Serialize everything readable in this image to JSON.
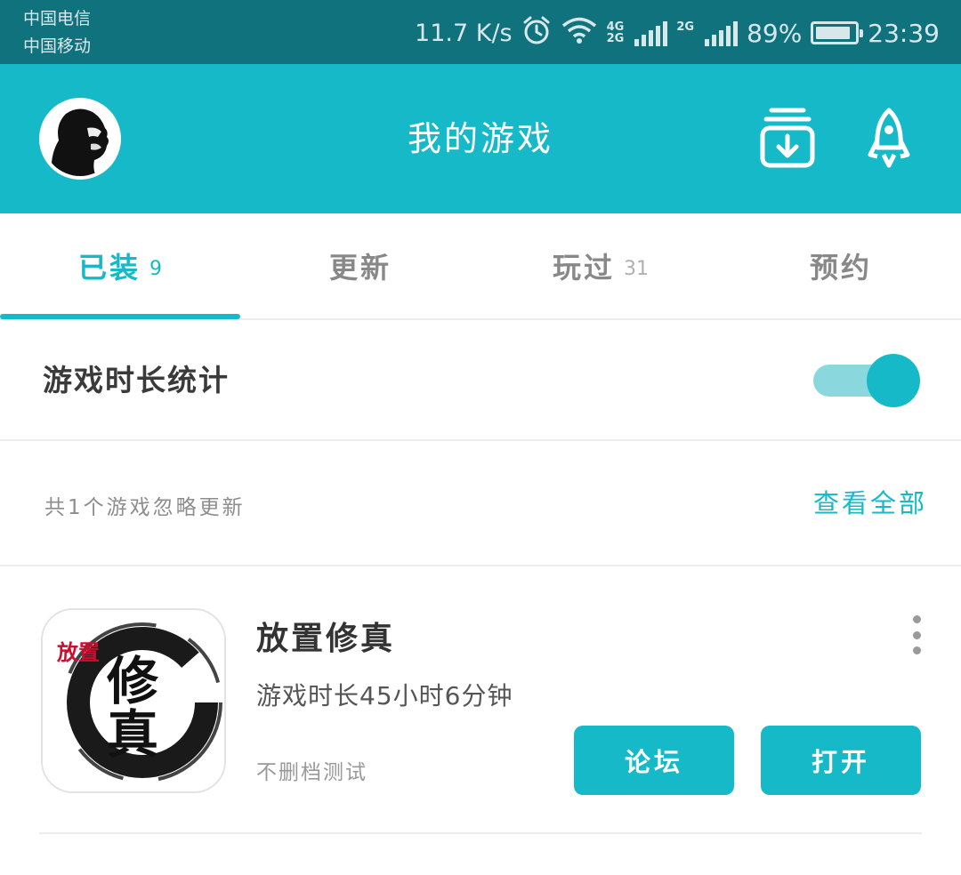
{
  "status_bar": {
    "carrier_1": "中国电信",
    "carrier_2": "中国移动",
    "net_speed": "11.7 K/s",
    "net_tag_1": "4G",
    "net_tag_2": "2G",
    "net_tag_3": "2G",
    "battery_pct": "89%",
    "battery_level": 0.89,
    "time": "23:39"
  },
  "header": {
    "title": "我的游戏",
    "icons": [
      "avatar",
      "download-icon",
      "rocket-icon"
    ]
  },
  "tabs": [
    {
      "label": "已装",
      "count": "9",
      "active": true
    },
    {
      "label": "更新",
      "count": "",
      "active": false
    },
    {
      "label": "玩过",
      "count": "31",
      "active": false
    },
    {
      "label": "预约",
      "count": "",
      "active": false
    }
  ],
  "stats": {
    "label": "游戏时长统计",
    "toggle_on": true
  },
  "ignore": {
    "text": "共1个游戏忽略更新",
    "link": "查看全部"
  },
  "games": [
    {
      "name": "放置修真",
      "playtime": "游戏时长45小时6分钟",
      "tag": "不删档测试",
      "icon_text_small": "放置",
      "icon_text_big_1": "修",
      "icon_text_big_2": "真",
      "forum_button": "论坛",
      "open_button": "打开"
    }
  ],
  "colors": {
    "accent": "#15b9c7",
    "status_bar": "#10727d",
    "icon_red": "#c8102e"
  }
}
